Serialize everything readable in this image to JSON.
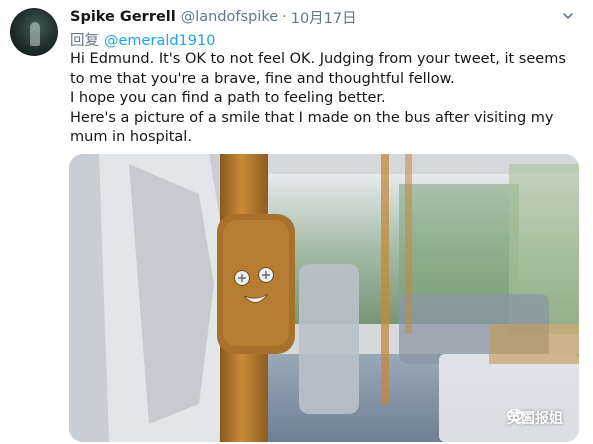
{
  "tweet": {
    "author_name": "Spike Gerrell",
    "author_handle": "@landofspike",
    "separator": "·",
    "date": "10月17日",
    "reply_prefix": "回复",
    "reply_to": "@emerald1910",
    "lines": [
      "Hi Edmund. It's OK to not feel OK. Judging from your tweet, it seems to me that you're a brave, fine and thoughtful fellow.",
      "I hope you can find a path to feeling better.",
      "Here's a picture of a smile that I made on the bus after visiting my mum in hospital."
    ]
  },
  "watermark": {
    "text": "英国报姐",
    "icon": "wechat-icon"
  },
  "icons": {
    "caret": "chevron-down-icon",
    "avatar": "avatar"
  },
  "colors": {
    "link": "#1da1f2",
    "secondary": "#657786",
    "text": "#14171a"
  }
}
